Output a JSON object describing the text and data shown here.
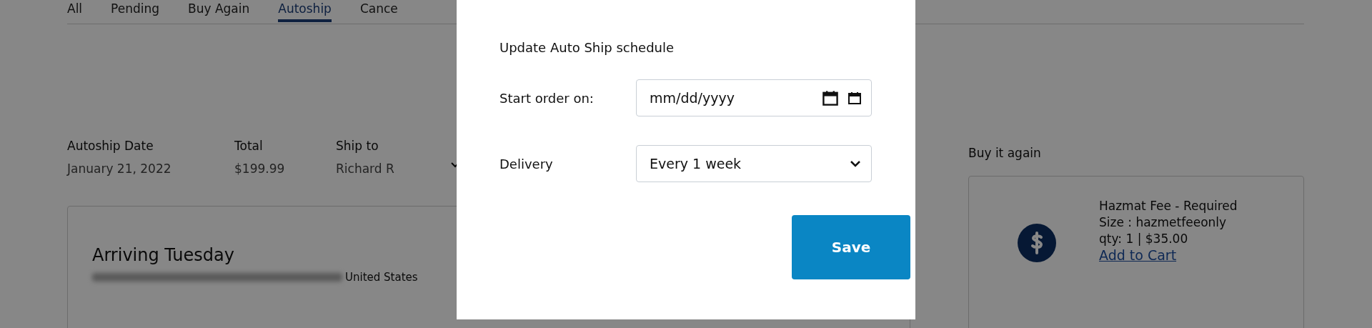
{
  "tabs": [
    {
      "label": "All",
      "selected": false
    },
    {
      "label": "Pending",
      "selected": false
    },
    {
      "label": "Buy Again",
      "selected": false
    },
    {
      "label": "Autoship",
      "selected": true
    },
    {
      "label": "Cance",
      "selected": false
    }
  ],
  "order": {
    "fields": [
      {
        "label": "Autoship Date",
        "value": "January 21, 2022"
      },
      {
        "label": "Total",
        "value": "$199.99"
      },
      {
        "label": "Ship to",
        "value": "Richard R"
      }
    ],
    "card": {
      "title": "Arriving Tuesday",
      "address_suffix": "United States"
    }
  },
  "buy_again": {
    "title": "Buy it again",
    "items": [
      {
        "name": "Hazmat Fee - Required",
        "size": "Size : hazmetfeeonly",
        "qty": "qty: 1 | $35.00",
        "link": "Add to Cart"
      }
    ]
  },
  "modal": {
    "title": "Update Auto Ship schedule",
    "start": {
      "label": "Start order on:",
      "placeholder": "mm/dd/yyyy"
    },
    "delivery": {
      "label": "Delivery",
      "value": "Every 1 week"
    },
    "save": "Save"
  }
}
